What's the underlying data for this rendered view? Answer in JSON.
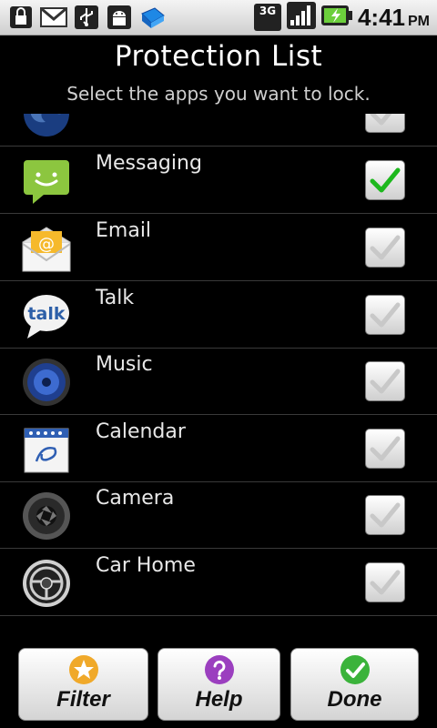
{
  "status_bar": {
    "time": "4:41",
    "ampm": "PM",
    "network": "3G",
    "icons": [
      "lock-icon",
      "gmail-icon",
      "usb-icon",
      "android-debug-icon",
      "app-update-icon"
    ]
  },
  "header": {
    "title": "Protection List",
    "subtitle": "Select the apps you want to lock."
  },
  "apps": [
    {
      "label": "",
      "icon": "browser-icon",
      "checked": false
    },
    {
      "label": "Messaging",
      "icon": "messaging-icon",
      "checked": true
    },
    {
      "label": "Email",
      "icon": "email-icon",
      "checked": false
    },
    {
      "label": "Talk",
      "icon": "talk-icon",
      "checked": false
    },
    {
      "label": "Music",
      "icon": "music-icon",
      "checked": false
    },
    {
      "label": "Calendar",
      "icon": "calendar-icon",
      "checked": false
    },
    {
      "label": "Camera",
      "icon": "camera-icon",
      "checked": false
    },
    {
      "label": "Car Home",
      "icon": "car-home-icon",
      "checked": false
    }
  ],
  "talk_icon_text": "talk",
  "email_icon_text": "@",
  "buttons": {
    "filter": "Filter",
    "help": "Help",
    "done": "Done"
  },
  "colors": {
    "check_on": "#1db81d",
    "check_off": "#c8c8c8",
    "filter_icon": "#f0a92a",
    "help_icon": "#9b3fbf",
    "done_icon": "#3bb33b"
  }
}
